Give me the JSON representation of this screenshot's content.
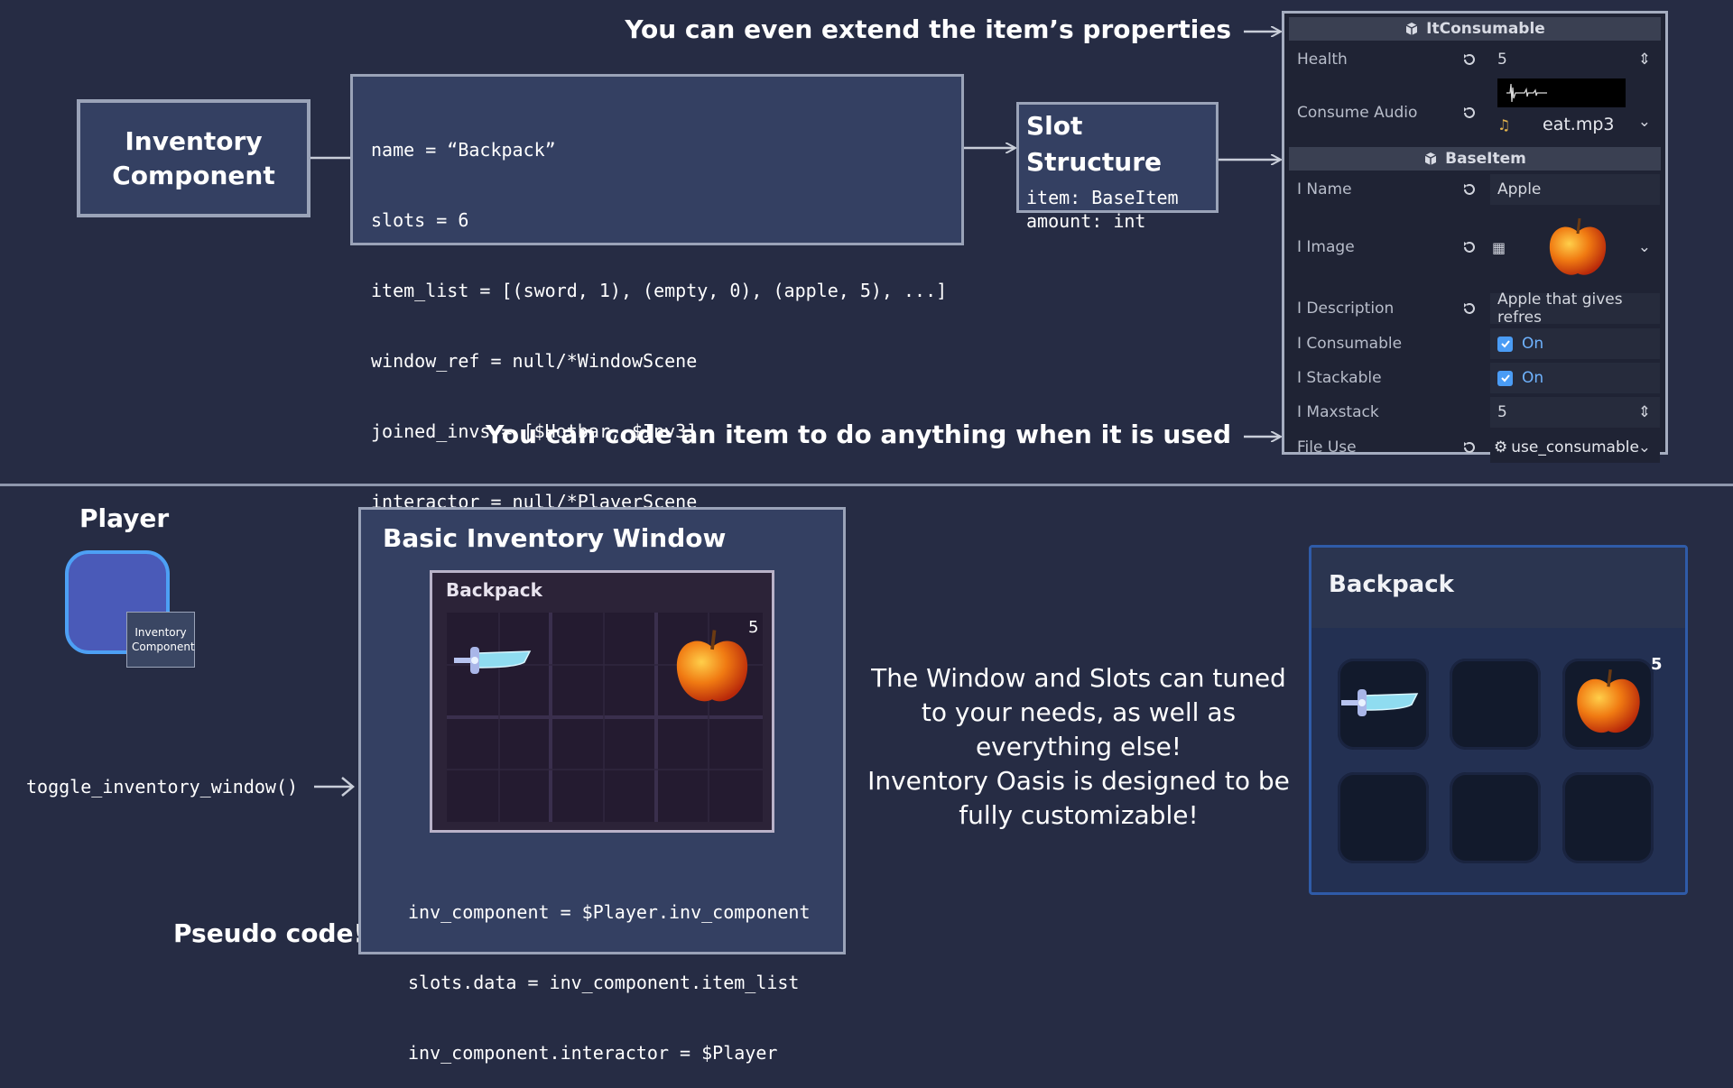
{
  "top": {
    "inventory_component_label": "Inventory Component",
    "code_lines": [
      "name = “Backpack”",
      "slots = 6",
      "item_list = [(sword, 1), (empty, 0), (apple, 5), ...]",
      "window_ref = null/*WindowScene",
      "joined_invs = [$Hotbar, $Inv3]",
      "interactor = null/*PlayerScene"
    ],
    "slot_structure": {
      "title": "Slot Structure",
      "line1": "item: BaseItem",
      "line2": "amount: int"
    },
    "note_extend": "You can even extend the item’s properties",
    "note_code": "You can code an item to do anything when it is used"
  },
  "inspector": {
    "section1_title": "ItConsumable",
    "section2_title": "BaseItem",
    "rows": {
      "health_label": "Health",
      "health_value": "5",
      "consume_audio_label": "Consume Audio",
      "consume_audio_value": "eat.mp3",
      "name_label": "I Name",
      "name_value": "Apple",
      "image_label": "I Image",
      "description_label": "I Description",
      "description_value": "Apple that gives refres",
      "consumable_label": "I Consumable",
      "consumable_value": "On",
      "stackable_label": "I Stackable",
      "stackable_value": "On",
      "maxstack_label": "I Maxstack",
      "maxstack_value": "5",
      "file_use_label": "File Use",
      "file_use_value": "use_consumable"
    }
  },
  "bottom": {
    "player_title": "Player",
    "player_component_label": "Inventory Component",
    "toggle_call": "toggle_inventory_window()",
    "pseudo_note": "Pseudo code!",
    "window_title": "Basic Inventory Window",
    "mini_window_title": "Backpack",
    "mini_apple_count": "5",
    "window_code_lines": [
      "inv_component = $Player.inv_component",
      "slots.data = inv_component.item_list",
      "inv_component.interactor = $Player"
    ],
    "center_text": [
      "The Window and Slots can tuned",
      "to your needs, as well as",
      "everything else!",
      "Inventory Oasis is designed to be",
      "fully customizable!"
    ],
    "backpack_title": "Backpack",
    "backpack_apple_count": "5"
  },
  "colors": {
    "background": "#262c44",
    "box_fill": "#344062",
    "box_border": "#9aa3b8",
    "accent_blue": "#4a9cf5",
    "backpack_border": "#2f5ba8"
  }
}
